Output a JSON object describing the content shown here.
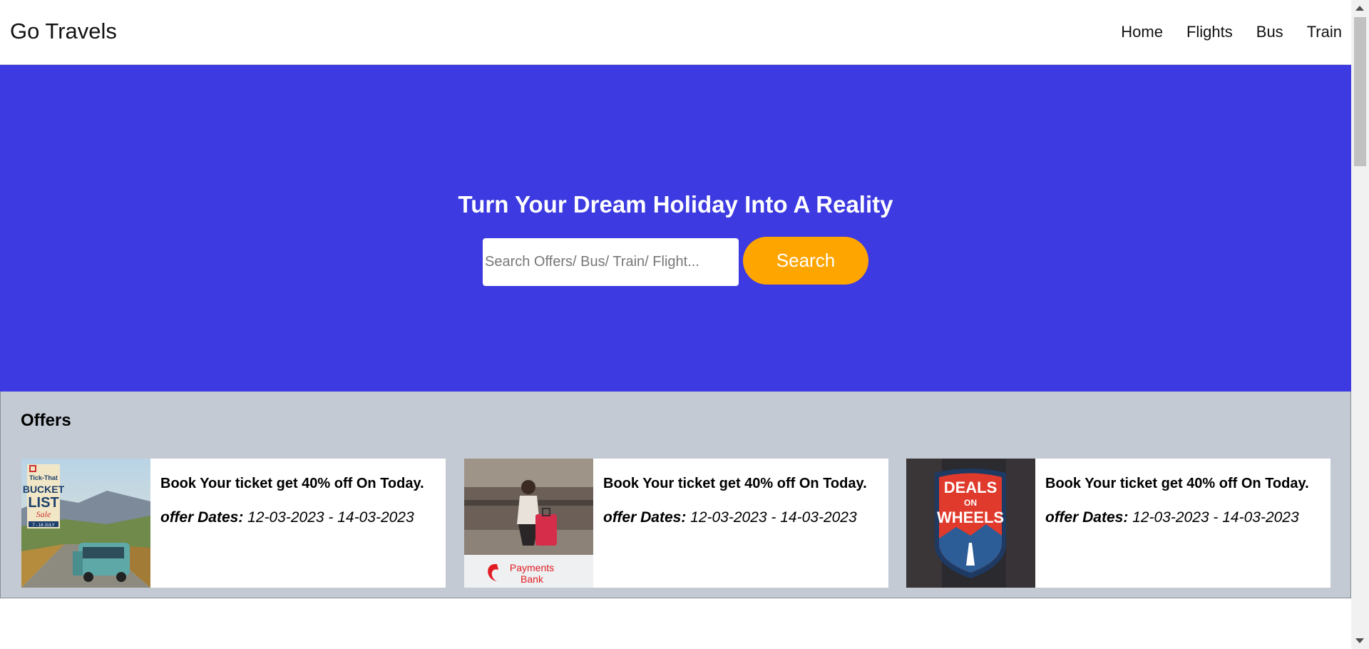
{
  "header": {
    "brand": "Go Travels",
    "nav": [
      "Home",
      "Flights",
      "Bus",
      "Train"
    ]
  },
  "hero": {
    "title": "Turn Your Dream Holiday Into A Reality",
    "search_placeholder": "Search Offers/ Bus/ Train/ Flight...",
    "search_button": "Search",
    "background_color": "#3c3ae0",
    "button_color": "#ffa500"
  },
  "offers": {
    "title": "Offers",
    "cards": [
      {
        "image_text": [
          "Tick-That",
          "BUCKET",
          "LIST",
          "Sale",
          "7 - 16 JULY"
        ],
        "title": "Book Your ticket get 40% off On Today.",
        "dates_label": "offer Dates:",
        "dates": "12-03-2023 - 14-03-2023"
      },
      {
        "image_text": [
          "Payments",
          "Bank"
        ],
        "title": "Book Your ticket get 40% off On Today.",
        "dates_label": "offer Dates:",
        "dates": "12-03-2023 - 14-03-2023"
      },
      {
        "image_text": [
          "DEALS",
          "ON",
          "WHEELS"
        ],
        "title": "Book Your ticket get 40% off On Today.",
        "dates_label": "offer Dates:",
        "dates": "12-03-2023 - 14-03-2023"
      }
    ]
  }
}
